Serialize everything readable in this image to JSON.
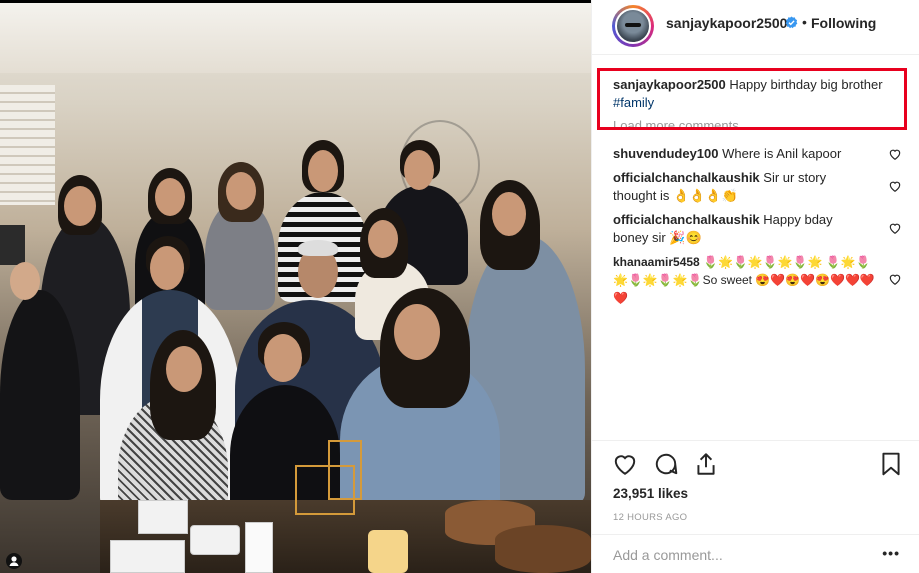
{
  "post_header": {
    "username": "sanjaykapoor2500",
    "separator": "•",
    "follow_status": "Following"
  },
  "caption": {
    "username": "sanjaykapoor2500",
    "text": " Happy birthday big brother ",
    "hashtag": "#family"
  },
  "load_more": "Load more comments",
  "comments": [
    {
      "user": "shuvendudey100",
      "text": " Where is Anil kapoor"
    },
    {
      "user": "officialchanchalkaushik",
      "text": " Sir ur story thought is 👌👌👌👏"
    },
    {
      "user": "officialchanchalkaushik",
      "text": " Happy bday boney sir 🎉😊"
    },
    {
      "user": "khanaamir5458",
      "text": " 🌷🌟🌷🌟🌷🌟🌷🌟 🌷🌟🌷🌟🌷🌟🌷🌟🌷So sweet 😍❤️😍❤️😍❤️❤️❤️❤️"
    }
  ],
  "engagement": {
    "likes": "23,951 likes",
    "timestamp": "12 HOURS AGO"
  },
  "comment_input": {
    "placeholder": "Add a comment...",
    "more_label": "•••"
  },
  "icons": {
    "like": "heart-icon",
    "comment": "comment-icon",
    "share": "share-icon",
    "save": "bookmark-icon",
    "verified": "verified-badge-icon",
    "comment_like": "heart-icon"
  },
  "colors": {
    "verified_blue": "#3897f0",
    "hashtag": "#003569",
    "highlight_box": "#e8001e",
    "muted_text": "#999999"
  }
}
